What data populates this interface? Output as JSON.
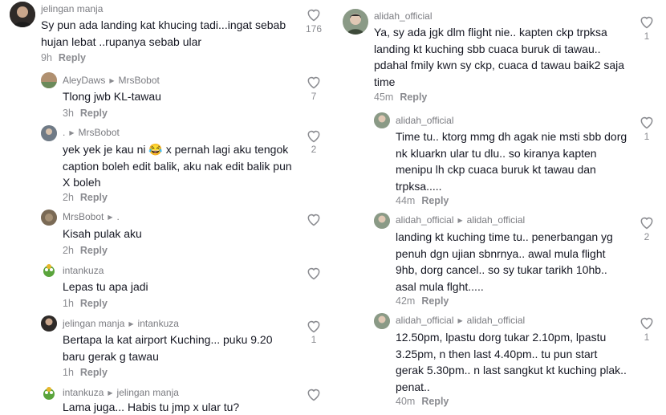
{
  "left": [
    {
      "user": "jelingan manja",
      "target": "",
      "text": "Sy pun ada landing kat khucing tadi...ingat sebab hujan lebat ..rupanya sebab ular",
      "time": "9h",
      "reply": "Reply",
      "likes": "176"
    },
    {
      "user": "AleyDaws",
      "target": "MrsBobot",
      "text": "Tlong jwb KL-tawau",
      "time": "3h",
      "reply": "Reply",
      "likes": "7"
    },
    {
      "user": ".",
      "target": "MrsBobot",
      "text": "yek yek je kau ni 😂 x pernah lagi aku tengok caption boleh edit balik, aku nak edit balik pun X boleh",
      "time": "2h",
      "reply": "Reply",
      "likes": "2"
    },
    {
      "user": "MrsBobot",
      "target": ".",
      "text": "Kisah pulak aku",
      "time": "2h",
      "reply": "Reply",
      "likes": ""
    },
    {
      "user": "intankuza",
      "target": "",
      "text": "Lepas tu apa jadi",
      "time": "1h",
      "reply": "Reply",
      "likes": ""
    },
    {
      "user": "jelingan manja",
      "target": "intankuza",
      "text": "Bertapa la kat airport Kuching... puku 9.20 baru gerak g tawau",
      "time": "1h",
      "reply": "Reply",
      "likes": "1"
    },
    {
      "user": "intankuza",
      "target": "jelingan manja",
      "text": "Lama juga... Habis tu jmp x ular tu?",
      "time": "",
      "reply": "",
      "likes": ""
    }
  ],
  "right": [
    {
      "user": "alidah_official",
      "target": "",
      "text": "Ya, sy ada jgk dlm flight nie.. kapten ckp trpksa landing kt kuching sbb cuaca buruk di tawau.. pdahal fmily kwn sy ckp, cuaca d tawau baik2 saja time",
      "time": "45m",
      "reply": "Reply",
      "likes": "1"
    },
    {
      "user": "alidah_official",
      "target": "",
      "text": "Time tu.. ktorg mmg dh agak nie msti sbb dorg nk kluarkn ular tu dlu.. so kiranya kapten menipu lh ckp cuaca buruk kt tawau dan trpksa.....",
      "time": "44m",
      "reply": "Reply",
      "likes": "1"
    },
    {
      "user": "alidah_official",
      "target": "alidah_official",
      "text": "landing kt kuching time tu.. penerbangan yg penuh dgn ujian sbnrnya.. awal mula flight 9hb, dorg cancel.. so sy tukar tarikh 10hb.. asal mula flght.....",
      "time": "42m",
      "reply": "Reply",
      "likes": "2"
    },
    {
      "user": "alidah_official",
      "target": "alidah_official",
      "text": "12.50pm, lpastu dorg tukar 2.10pm, lpastu 3.25pm, n then last 4.40pm.. tu pun start gerak 5.30pm.. n last sangkut kt kuching plak.. penat..",
      "time": "40m",
      "reply": "Reply",
      "likes": "1"
    }
  ]
}
